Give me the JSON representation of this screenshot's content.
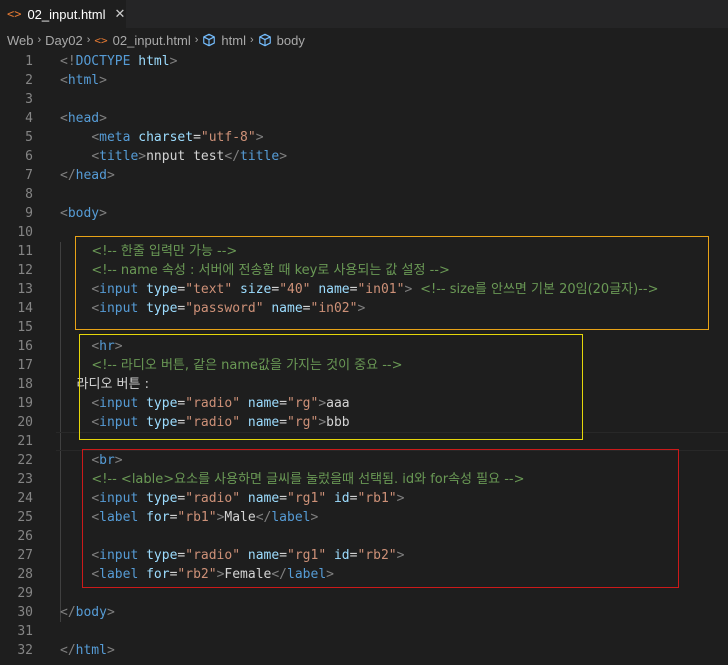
{
  "tab": {
    "icon": "<>",
    "title": "02_input.html",
    "close_icon": "✕"
  },
  "breadcrumb": {
    "items": [
      "Web",
      "Day02",
      "02_input.html",
      "html",
      "body"
    ],
    "separator": "›"
  },
  "colors": {
    "box1": "#e8a317",
    "box2": "#e5d60a",
    "box3": "#cc1a1a"
  },
  "editor": {
    "lines": [
      {
        "n": "1",
        "tokens": [
          [
            "br",
            "<!"
          ],
          [
            "tag",
            "DOCTYPE"
          ],
          [
            "txt",
            " "
          ],
          [
            "attr",
            "html"
          ],
          [
            "br",
            ">"
          ]
        ]
      },
      {
        "n": "2",
        "tokens": [
          [
            "br",
            "<"
          ],
          [
            "tag",
            "html"
          ],
          [
            "br",
            ">"
          ]
        ]
      },
      {
        "n": "3",
        "tokens": []
      },
      {
        "n": "4",
        "tokens": [
          [
            "br",
            "<"
          ],
          [
            "tag",
            "head"
          ],
          [
            "br",
            ">"
          ]
        ]
      },
      {
        "n": "5",
        "tokens": [
          [
            "txt",
            "    "
          ],
          [
            "br",
            "<"
          ],
          [
            "tag",
            "meta"
          ],
          [
            "txt",
            " "
          ],
          [
            "attr",
            "charset"
          ],
          [
            "txt",
            "="
          ],
          [
            "str",
            "\"utf-8\""
          ],
          [
            "br",
            ">"
          ]
        ]
      },
      {
        "n": "6",
        "tokens": [
          [
            "txt",
            "    "
          ],
          [
            "br",
            "<"
          ],
          [
            "tag",
            "title"
          ],
          [
            "br",
            ">"
          ],
          [
            "txt",
            "nnput test"
          ],
          [
            "br",
            "</"
          ],
          [
            "tag",
            "title"
          ],
          [
            "br",
            ">"
          ]
        ]
      },
      {
        "n": "7",
        "tokens": [
          [
            "br",
            "</"
          ],
          [
            "tag",
            "head"
          ],
          [
            "br",
            ">"
          ]
        ]
      },
      {
        "n": "8",
        "tokens": []
      },
      {
        "n": "9",
        "tokens": [
          [
            "br",
            "<"
          ],
          [
            "tag",
            "body"
          ],
          [
            "br",
            ">"
          ]
        ]
      },
      {
        "n": "10",
        "tokens": []
      },
      {
        "n": "11",
        "tokens": [
          [
            "txt",
            "    "
          ],
          [
            "com",
            "<!-- 한줄 입력만 가능 -->"
          ]
        ]
      },
      {
        "n": "12",
        "tokens": [
          [
            "txt",
            "    "
          ],
          [
            "com",
            "<!-- name 속성 : 서버에 전송할 때 key로 사용되는 값 설정 -->"
          ]
        ]
      },
      {
        "n": "13",
        "tokens": [
          [
            "txt",
            "    "
          ],
          [
            "br",
            "<"
          ],
          [
            "tag",
            "input"
          ],
          [
            "txt",
            " "
          ],
          [
            "attr",
            "type"
          ],
          [
            "txt",
            "="
          ],
          [
            "str",
            "\"text\""
          ],
          [
            "txt",
            " "
          ],
          [
            "attr",
            "size"
          ],
          [
            "txt",
            "="
          ],
          [
            "str",
            "\"40\""
          ],
          [
            "txt",
            " "
          ],
          [
            "attr",
            "name"
          ],
          [
            "txt",
            "="
          ],
          [
            "str",
            "\"in01\""
          ],
          [
            "br",
            ">"
          ],
          [
            "txt",
            " "
          ],
          [
            "com",
            "<!-- size를 안쓰면 기본 20임(20글자)-->"
          ]
        ]
      },
      {
        "n": "14",
        "tokens": [
          [
            "txt",
            "    "
          ],
          [
            "br",
            "<"
          ],
          [
            "tag",
            "input"
          ],
          [
            "txt",
            " "
          ],
          [
            "attr",
            "type"
          ],
          [
            "txt",
            "="
          ],
          [
            "str",
            "\"password\""
          ],
          [
            "txt",
            " "
          ],
          [
            "attr",
            "name"
          ],
          [
            "txt",
            "="
          ],
          [
            "str",
            "\"in02\""
          ],
          [
            "br",
            ">"
          ]
        ]
      },
      {
        "n": "15",
        "tokens": []
      },
      {
        "n": "16",
        "tokens": [
          [
            "txt",
            "    "
          ],
          [
            "br",
            "<"
          ],
          [
            "tag",
            "hr"
          ],
          [
            "br",
            ">"
          ]
        ]
      },
      {
        "n": "17",
        "tokens": [
          [
            "txt",
            "    "
          ],
          [
            "com",
            "<!-- 라디오 버튼, 같은 name값을 가지는 것이 중요 -->"
          ]
        ]
      },
      {
        "n": "18",
        "tokens": [
          [
            "txt",
            "    라디오 버튼 :"
          ]
        ]
      },
      {
        "n": "19",
        "tokens": [
          [
            "txt",
            "    "
          ],
          [
            "br",
            "<"
          ],
          [
            "tag",
            "input"
          ],
          [
            "txt",
            " "
          ],
          [
            "attr",
            "type"
          ],
          [
            "txt",
            "="
          ],
          [
            "str",
            "\"radio\""
          ],
          [
            "txt",
            " "
          ],
          [
            "attr",
            "name"
          ],
          [
            "txt",
            "="
          ],
          [
            "str",
            "\"rg\""
          ],
          [
            "br",
            ">"
          ],
          [
            "txt",
            "aaa"
          ]
        ]
      },
      {
        "n": "20",
        "tokens": [
          [
            "txt",
            "    "
          ],
          [
            "br",
            "<"
          ],
          [
            "tag",
            "input"
          ],
          [
            "txt",
            " "
          ],
          [
            "attr",
            "type"
          ],
          [
            "txt",
            "="
          ],
          [
            "str",
            "\"radio\""
          ],
          [
            "txt",
            " "
          ],
          [
            "attr",
            "name"
          ],
          [
            "txt",
            "="
          ],
          [
            "str",
            "\"rg\""
          ],
          [
            "br",
            ">"
          ],
          [
            "txt",
            "bbb"
          ]
        ]
      },
      {
        "n": "21",
        "tokens": []
      },
      {
        "n": "22",
        "tokens": [
          [
            "txt",
            "    "
          ],
          [
            "br",
            "<"
          ],
          [
            "tag",
            "br"
          ],
          [
            "br",
            ">"
          ]
        ]
      },
      {
        "n": "23",
        "tokens": [
          [
            "txt",
            "    "
          ],
          [
            "com",
            "<!-- <lable>요소를 사용하면 글씨를 눌렀을때 선택됨. id와 for속성 필요 -->"
          ]
        ]
      },
      {
        "n": "24",
        "tokens": [
          [
            "txt",
            "    "
          ],
          [
            "br",
            "<"
          ],
          [
            "tag",
            "input"
          ],
          [
            "txt",
            " "
          ],
          [
            "attr",
            "type"
          ],
          [
            "txt",
            "="
          ],
          [
            "str",
            "\"radio\""
          ],
          [
            "txt",
            " "
          ],
          [
            "attr",
            "name"
          ],
          [
            "txt",
            "="
          ],
          [
            "str",
            "\"rg1\""
          ],
          [
            "txt",
            " "
          ],
          [
            "attr",
            "id"
          ],
          [
            "txt",
            "="
          ],
          [
            "str",
            "\"rb1\""
          ],
          [
            "br",
            ">"
          ]
        ]
      },
      {
        "n": "25",
        "tokens": [
          [
            "txt",
            "    "
          ],
          [
            "br",
            "<"
          ],
          [
            "tag",
            "label"
          ],
          [
            "txt",
            " "
          ],
          [
            "attr",
            "for"
          ],
          [
            "txt",
            "="
          ],
          [
            "str",
            "\"rb1\""
          ],
          [
            "br",
            ">"
          ],
          [
            "txt",
            "Male"
          ],
          [
            "br",
            "</"
          ],
          [
            "tag",
            "label"
          ],
          [
            "br",
            ">"
          ]
        ]
      },
      {
        "n": "26",
        "tokens": []
      },
      {
        "n": "27",
        "tokens": [
          [
            "txt",
            "    "
          ],
          [
            "br",
            "<"
          ],
          [
            "tag",
            "input"
          ],
          [
            "txt",
            " "
          ],
          [
            "attr",
            "type"
          ],
          [
            "txt",
            "="
          ],
          [
            "str",
            "\"radio\""
          ],
          [
            "txt",
            " "
          ],
          [
            "attr",
            "name"
          ],
          [
            "txt",
            "="
          ],
          [
            "str",
            "\"rg1\""
          ],
          [
            "txt",
            " "
          ],
          [
            "attr",
            "id"
          ],
          [
            "txt",
            "="
          ],
          [
            "str",
            "\"rb2\""
          ],
          [
            "br",
            ">"
          ]
        ]
      },
      {
        "n": "28",
        "tokens": [
          [
            "txt",
            "    "
          ],
          [
            "br",
            "<"
          ],
          [
            "tag",
            "label"
          ],
          [
            "txt",
            " "
          ],
          [
            "attr",
            "for"
          ],
          [
            "txt",
            "="
          ],
          [
            "str",
            "\"rb2\""
          ],
          [
            "br",
            ">"
          ],
          [
            "txt",
            "Female"
          ],
          [
            "br",
            "</"
          ],
          [
            "tag",
            "label"
          ],
          [
            "br",
            ">"
          ]
        ]
      },
      {
        "n": "29",
        "tokens": []
      },
      {
        "n": "30",
        "tokens": [
          [
            "br",
            "</"
          ],
          [
            "tag",
            "body"
          ],
          [
            "br",
            ">"
          ]
        ]
      },
      {
        "n": "31",
        "tokens": []
      },
      {
        "n": "32",
        "tokens": [
          [
            "br",
            "</"
          ],
          [
            "tag",
            "html"
          ],
          [
            "br",
            ">"
          ]
        ]
      }
    ]
  }
}
